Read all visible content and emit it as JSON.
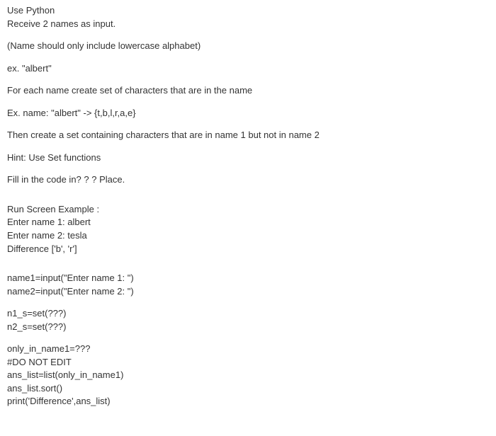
{
  "instructions": {
    "line1": "Use Python",
    "line2": "Receive 2 names as input.",
    "line3": "(Name should only include lowercase alphabet)",
    "line4": "ex. \"albert\"",
    "line5": "For each name create set of characters that are in the name",
    "line6": "Ex. name: \"albert\" -> {t,b,l,r,a,e}",
    "line7": "Then create a set containing characters that are in name 1 but not in name 2",
    "line8": "Hint: Use Set functions",
    "line9": "Fill in the code in? ? ? Place."
  },
  "run_example": {
    "header": "Run Screen Example :",
    "l1": "Enter name 1: albert",
    "l2": "Enter name 2: tesla",
    "l3": "Difference ['b', 'r']"
  },
  "code": {
    "c1": "name1=input(\"Enter name 1: \")",
    "c2": "name2=input(\"Enter name 2: \")",
    "c3": "n1_s=set(???)",
    "c4": "n2_s=set(???)",
    "c5": "only_in_name1=???",
    "c6": "#DO NOT EDIT",
    "c7": "ans_list=list(only_in_name1)",
    "c8": "ans_list.sort()",
    "c9": "print('Difference',ans_list)"
  }
}
